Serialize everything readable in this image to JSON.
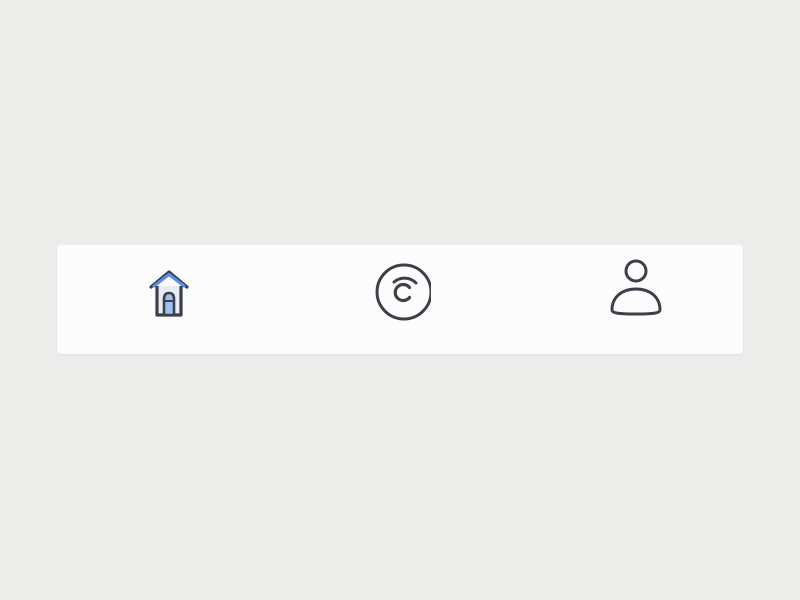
{
  "tab_bar": {
    "active_tab": "home",
    "tabs": [
      {
        "id": "home",
        "icon": "home-icon",
        "label": ""
      },
      {
        "id": "coins",
        "icon": "copyright-coin-icon",
        "label": ""
      },
      {
        "id": "profile",
        "icon": "user-icon",
        "label": ""
      }
    ]
  },
  "colors": {
    "background": "#ececeb",
    "bar": "#fcfcfc",
    "icon_stroke": "#3c4149",
    "accent": "#5b8def",
    "accent_fill": "#9fc0f5"
  }
}
